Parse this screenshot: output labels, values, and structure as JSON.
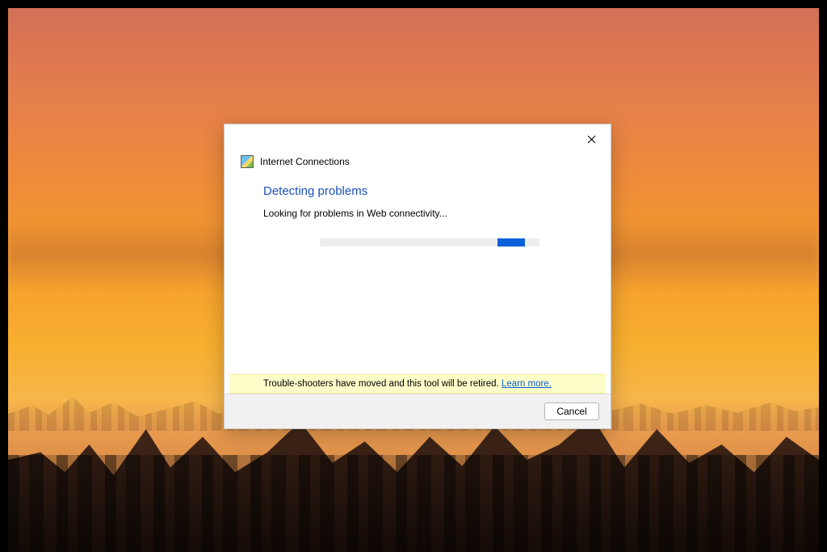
{
  "dialog": {
    "title": "Internet Connections",
    "step_title": "Detecting problems",
    "step_description": "Looking for problems in Web connectivity...",
    "notice_text": "Trouble-shooters have moved and this tool will be retired. ",
    "learn_more_label": "Learn more.",
    "cancel_label": "Cancel"
  }
}
